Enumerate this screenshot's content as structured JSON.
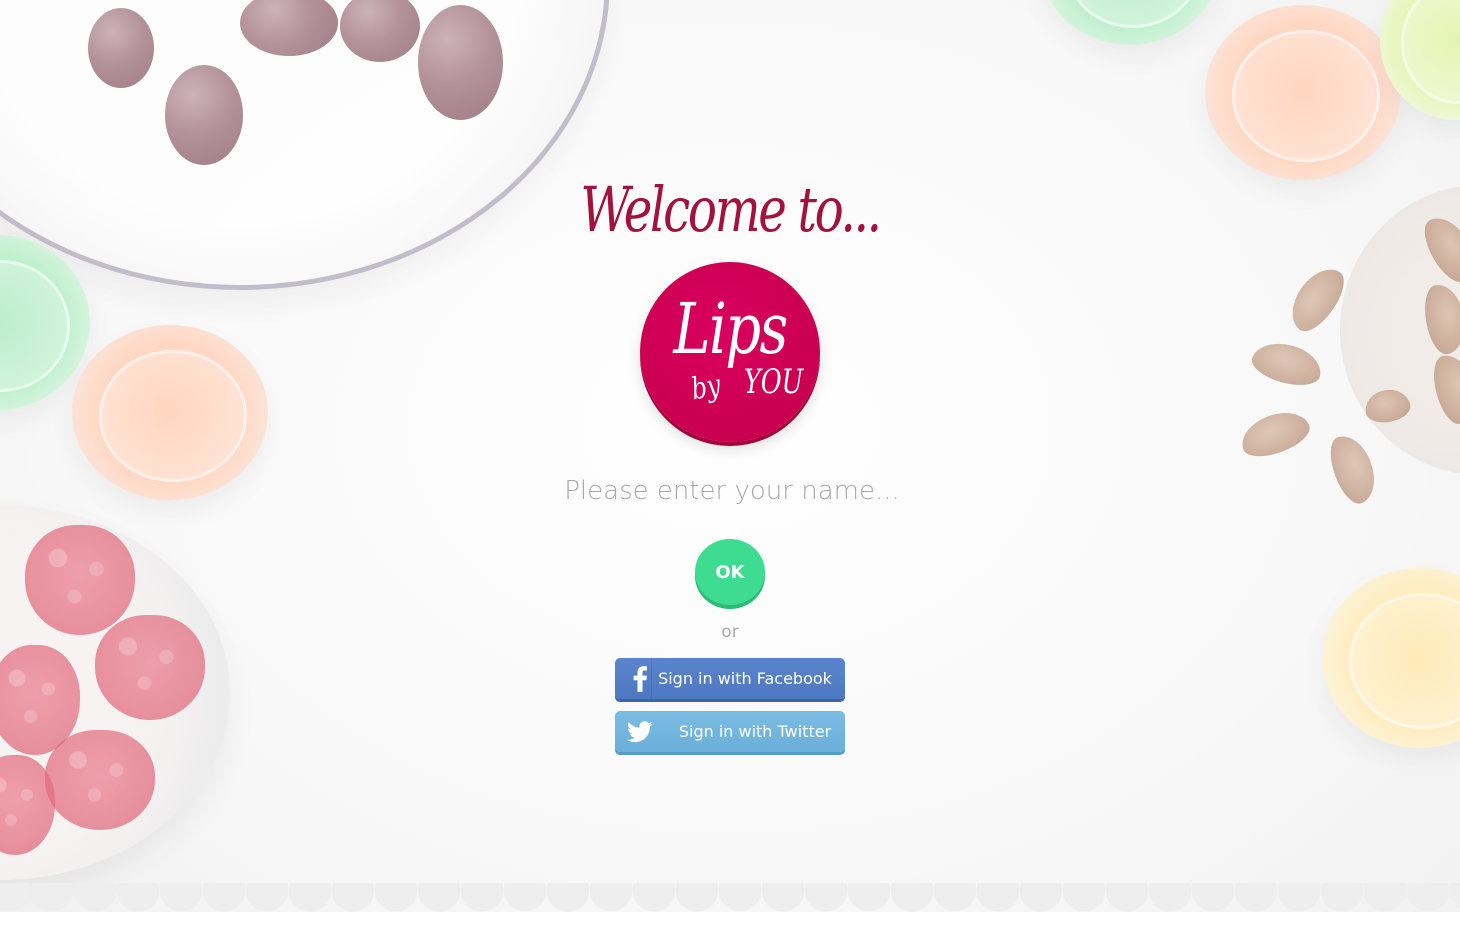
{
  "welcome": {
    "heading": "Welcome to..."
  },
  "logo": {
    "line1": "Lips",
    "line2": "by",
    "line3": "YOU"
  },
  "name_form": {
    "placeholder": "Please enter your name...",
    "value": "",
    "submit_label": "OK"
  },
  "divider_text": "or",
  "social": {
    "facebook_label": "Sign in with Facebook",
    "twitter_label": "Sign in with Twitter",
    "facebook_icon": "facebook-icon",
    "twitter_icon": "twitter-icon"
  },
  "colors": {
    "brand": "#c8004f",
    "heading": "#a3123c",
    "ok": "#3ddc90",
    "facebook": "#5580c6",
    "twitter": "#74b6df"
  }
}
